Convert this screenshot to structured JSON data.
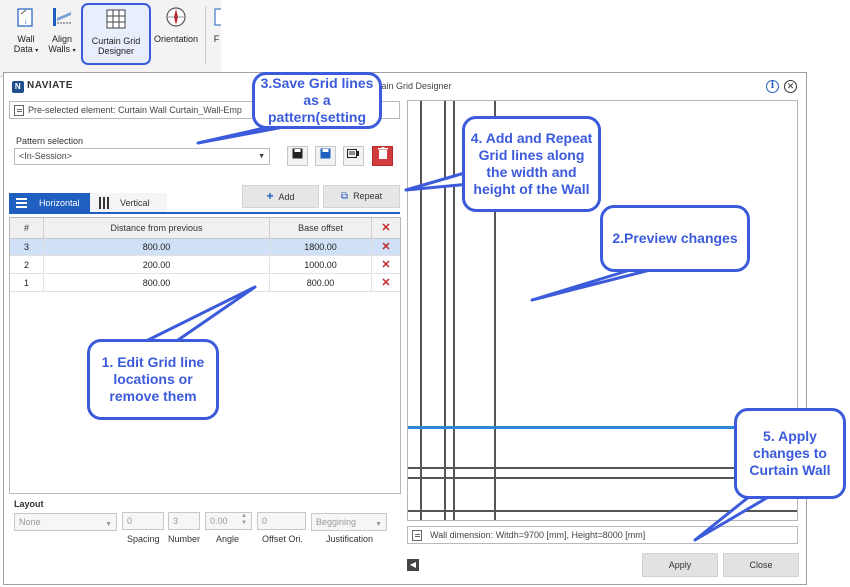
{
  "ribbon": {
    "buttons": [
      {
        "label": "Wall",
        "label2": "Data",
        "icon": "wall-data-icon"
      },
      {
        "label": "Align",
        "label2": "Walls",
        "icon": "align-walls-icon"
      },
      {
        "label": "Curtain Grid",
        "label2": "Designer",
        "icon": "curtain-grid-icon"
      },
      {
        "label": "Orientation",
        "label2": "",
        "icon": "compass-icon"
      },
      {
        "label": "F",
        "label2": "",
        "icon": "partial-icon"
      }
    ]
  },
  "dialog": {
    "logo": "NAVIATE",
    "title": "rtain Grid Designer",
    "preselected": "Pre-selected element: Curtain Wall Curtain_Wall-Emp",
    "pattern_label": "Pattern selection",
    "pattern_value": "<In-Session>",
    "tabs": {
      "horizontal": "Horizontal",
      "vertical": "Vertical"
    },
    "add_label": "Add",
    "repeat_label": "Repeat",
    "table": {
      "headers": [
        "#",
        "Distance from previous",
        "Base offset",
        "✕"
      ],
      "rows": [
        {
          "num": "3",
          "distance": "800.00",
          "offset": "1800.00"
        },
        {
          "num": "2",
          "distance": "200.00",
          "offset": "1000.00"
        },
        {
          "num": "1",
          "distance": "800.00",
          "offset": "800.00"
        }
      ]
    },
    "layout": {
      "title": "Layout",
      "mode": "None",
      "spacing": "0",
      "number": "3",
      "angle": "0.00",
      "offset": "0",
      "justification": "Beggining",
      "captions": {
        "spacing": "Spacing",
        "number": "Number",
        "angle": "Angle",
        "offset": "Offset Ori.",
        "justification": "Justification"
      }
    },
    "wall_dimension": "Wall dimension: Witdh=9700 [mm], Height=8000 [mm]",
    "apply_label": "Apply",
    "close_label": "Close"
  },
  "callouts": {
    "save": "3.Save Grid lines as a pattern(setting",
    "add_repeat": "4. Add and Repeat Grid lines along the width and height of the Wall",
    "preview": "2.Preview changes",
    "edit": "1. Edit Grid line locations or remove them",
    "apply": "5. Apply changes to Curtain Wall"
  },
  "colors": {
    "accent": "#1f5fbf",
    "callout": "#3b5bdb",
    "delete": "#c0262c",
    "preview_line": "#2e86d6"
  }
}
